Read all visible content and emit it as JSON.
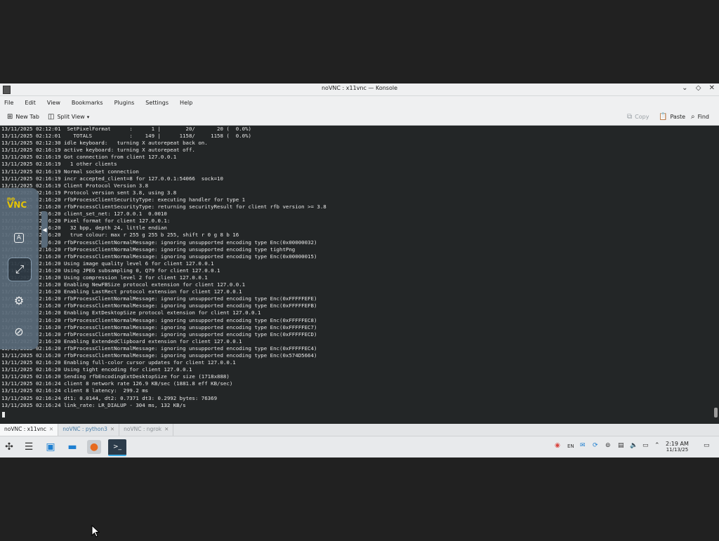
{
  "window": {
    "title": "noVNC : x11vnc — Konsole",
    "controls": [
      "⌄",
      "◇",
      "✕"
    ]
  },
  "menu": [
    "File",
    "Edit",
    "View",
    "Bookmarks",
    "Plugins",
    "Settings",
    "Help"
  ],
  "toolbar": {
    "new_tab": "New Tab",
    "split_view": "Split View",
    "copy": "Copy",
    "paste": "Paste",
    "find": "Find"
  },
  "terminal_lines": [
    "13/11/2025 02:12:01  SetPixelFormat      :      1 |        20/       20 (  0.0%)",
    "13/11/2025 02:12:01    TOTALS            :    149 |      1158/     1158 (  0.0%)",
    "13/11/2025 02:12:30 idle keyboard:   turning X autorepeat back on.",
    "13/11/2025 02:16:19 active keyboard: turning X autorepeat off.",
    "13/11/2025 02:16:19 Got connection from client 127.0.0.1",
    "13/11/2025 02:16:19   1 other clients",
    "13/11/2025 02:16:19 Normal socket connection",
    "13/11/2025 02:16:19 incr accepted_client=8 for 127.0.0.1:54066  sock=10",
    "13/11/2025 02:16:19 Client Protocol Version 3.8",
    "13/11/2025 02:16:19 Protocol version sent 3.8, using 3.8",
    "13/11/2025 02:16:20 rfbProcessClientSecurityType: executing handler for type 1",
    "13/11/2025 02:16:20 rfbProcessClientSecurityType: returning securityResult for client rfb version >= 3.8",
    "13/11/2025 02:16:20 client_set_net: 127.0.0.1  0.0010",
    "13/11/2025 02:16:20 Pixel format for client 127.0.0.1:",
    "13/11/2025 02:16:20   32 bpp, depth 24, little endian",
    "13/11/2025 02:16:20   true colour: max r 255 g 255 b 255, shift r 0 g 8 b 16",
    "13/11/2025 02:16:20 rfbProcessClientNormalMessage: ignoring unsupported encoding type Enc(0x00000032)",
    "13/11/2025 02:16:20 rfbProcessClientNormalMessage: ignoring unsupported encoding type tightPng",
    "13/11/2025 02:16:20 rfbProcessClientNormalMessage: ignoring unsupported encoding type Enc(0x00000015)",
    "13/11/2025 02:16:20 Using image quality level 6 for client 127.0.0.1",
    "13/11/2025 02:16:20 Using JPEG subsampling 0, Q79 for client 127.0.0.1",
    "13/11/2025 02:16:20 Using compression level 2 for client 127.0.0.1",
    "13/11/2025 02:16:20 Enabling NewFBSize protocol extension for client 127.0.0.1",
    "13/11/2025 02:16:20 Enabling LastRect protocol extension for client 127.0.0.1",
    "13/11/2025 02:16:20 rfbProcessClientNormalMessage: ignoring unsupported encoding type Enc(0xFFFFFEFE)",
    "13/11/2025 02:16:20 rfbProcessClientNormalMessage: ignoring unsupported encoding type Enc(0xFFFFFEFB)",
    "13/11/2025 02:16:20 Enabling ExtDesktopSize protocol extension for client 127.0.0.1",
    "13/11/2025 02:16:20 rfbProcessClientNormalMessage: ignoring unsupported encoding type Enc(0xFFFFFEC8)",
    "13/11/2025 02:16:20 rfbProcessClientNormalMessage: ignoring unsupported encoding type Enc(0xFFFFFEC7)",
    "13/11/2025 02:16:20 rfbProcessClientNormalMessage: ignoring unsupported encoding type Enc(0xFFFFFECD)",
    "13/11/2025 02:16:20 Enabling ExtendedClipboard extension for client 127.0.0.1",
    "13/11/2025 02:16:20 rfbProcessClientNormalMessage: ignoring unsupported encoding type Enc(0xFFFFFEC4)",
    "13/11/2025 02:16:20 rfbProcessClientNormalMessage: ignoring unsupported encoding type Enc(0x574D5664)",
    "13/11/2025 02:16:20 Enabling full-color cursor updates for client 127.0.0.1",
    "13/11/2025 02:16:20 Using tight encoding for client 127.0.0.1",
    "13/11/2025 02:16:20 Sending rfbEncodingExtDesktopSize for size (1718x888)",
    "13/11/2025 02:16:24 client 8 network rate 126.9 KB/sec (1881.8 eff KB/sec)",
    "13/11/2025 02:16:24 client 8 latency:  299.2 ms",
    "13/11/2025 02:16:24 dt1: 0.0144, dt2: 0.7371 dt3: 0.2992 bytes: 76369",
    "13/11/2025 02:16:24 link_rate: LR_DIALUP - 304 ms, 132 KB/s"
  ],
  "tabs": [
    {
      "label": "noVNC : x11vnc",
      "active": true
    },
    {
      "label": "noVNC : python3",
      "active": false
    },
    {
      "label": "noVNC : ngrok",
      "active": false
    }
  ],
  "novnc": {
    "logo_top": "no",
    "logo_bottom": "VNC"
  },
  "clock": {
    "time": "2:19 AM",
    "date": "11/13/25"
  },
  "tray_lang": "EN",
  "colors": {
    "terminal_bg": "#232627",
    "accent": "#3daee9",
    "novnc_yellow": "#f5d000"
  }
}
